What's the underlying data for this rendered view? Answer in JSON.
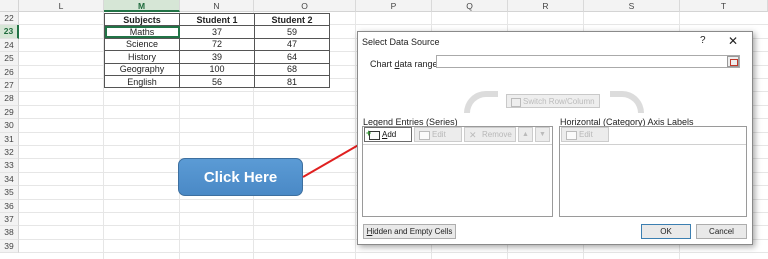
{
  "spreadsheet": {
    "columns": [
      "L",
      "M",
      "N",
      "O",
      "P",
      "Q",
      "R",
      "S",
      "T"
    ],
    "active_column": "M",
    "rows": [
      "22",
      "23",
      "24",
      "25",
      "26",
      "27",
      "28",
      "29",
      "30",
      "31",
      "32",
      "33",
      "34",
      "35",
      "36",
      "37",
      "38",
      "39"
    ],
    "active_row": "23",
    "table": {
      "headers": [
        "Subjects",
        "Student 1",
        "Student 2"
      ],
      "rows": [
        [
          "Maths",
          "37",
          "59"
        ],
        [
          "Science",
          "72",
          "47"
        ],
        [
          "History",
          "39",
          "64"
        ],
        [
          "Geography",
          "100",
          "68"
        ],
        [
          "English",
          "56",
          "81"
        ]
      ]
    }
  },
  "callout": {
    "label": "Click Here",
    "color": "#5b9bd5",
    "arrow_color": "#e02020"
  },
  "dialog": {
    "title": "Select Data Source",
    "help": "?",
    "close": "✕",
    "chart_range_label_pre": "Chart ",
    "chart_range_label_u": "d",
    "chart_range_label_post": "ata range:",
    "chart_range_value": "",
    "switch_label": "Switch Row/Column",
    "legend_label_pre": "Legend Entries (",
    "legend_label_u": "S",
    "legend_label_post": "eries)",
    "axis_label_pre": "Horizontal (",
    "axis_label_u": "C",
    "axis_label_post": "ategory) Axis Labels",
    "add_u": "A",
    "add_rest": "dd",
    "edit_label": "Edit",
    "remove_label": "Remove",
    "up_arrow": "▲",
    "down_arrow": "▼",
    "axis_edit_label": "Edit",
    "hidden_u": "H",
    "hidden_rest": "idden and Empty Cells",
    "ok_label": "OK",
    "cancel_label": "Cancel"
  }
}
